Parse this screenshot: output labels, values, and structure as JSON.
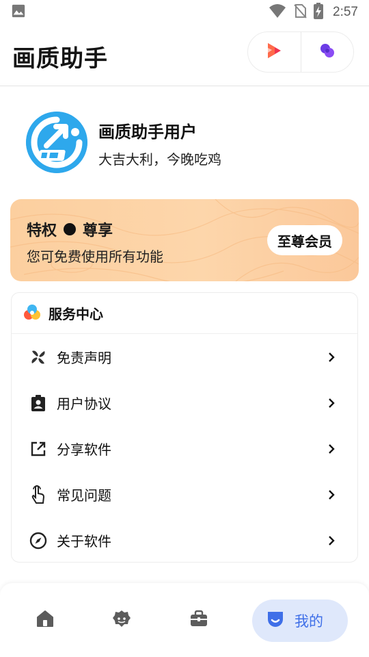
{
  "status_bar": {
    "time": "2:57",
    "icons": [
      "image-icon",
      "wifi-icon",
      "no-sim-icon",
      "battery-charging-icon"
    ]
  },
  "header": {
    "title": "画质助手",
    "actions": [
      {
        "icon": "play-icon",
        "color": "#f0344f"
      },
      {
        "icon": "bubbles-icon",
        "color": "#7d3ff0"
      }
    ]
  },
  "profile": {
    "avatar_icon": "huazhi-logo",
    "name": "画质助手用户",
    "motto": "大吉大利，今晚吃鸡"
  },
  "vip": {
    "title_left": "特权",
    "title_right": "尊享",
    "subtitle": "您可免费使用所有功能",
    "button_label": "至尊会员"
  },
  "service": {
    "title": "服务中心",
    "items": [
      {
        "label": "免责声明",
        "icon": "pinwheel-icon"
      },
      {
        "label": "用户协议",
        "icon": "badge-icon"
      },
      {
        "label": "分享软件",
        "icon": "share-icon"
      },
      {
        "label": "常见问题",
        "icon": "touch-icon"
      },
      {
        "label": "关于软件",
        "icon": "compass-icon"
      }
    ]
  },
  "bottom_nav": {
    "tabs": [
      {
        "icon": "home-icon"
      },
      {
        "icon": "face-icon"
      },
      {
        "icon": "toolbox-icon"
      },
      {
        "icon": "profile-icon",
        "label": "我的",
        "active": true
      }
    ],
    "accent": "#3f6fe8"
  }
}
